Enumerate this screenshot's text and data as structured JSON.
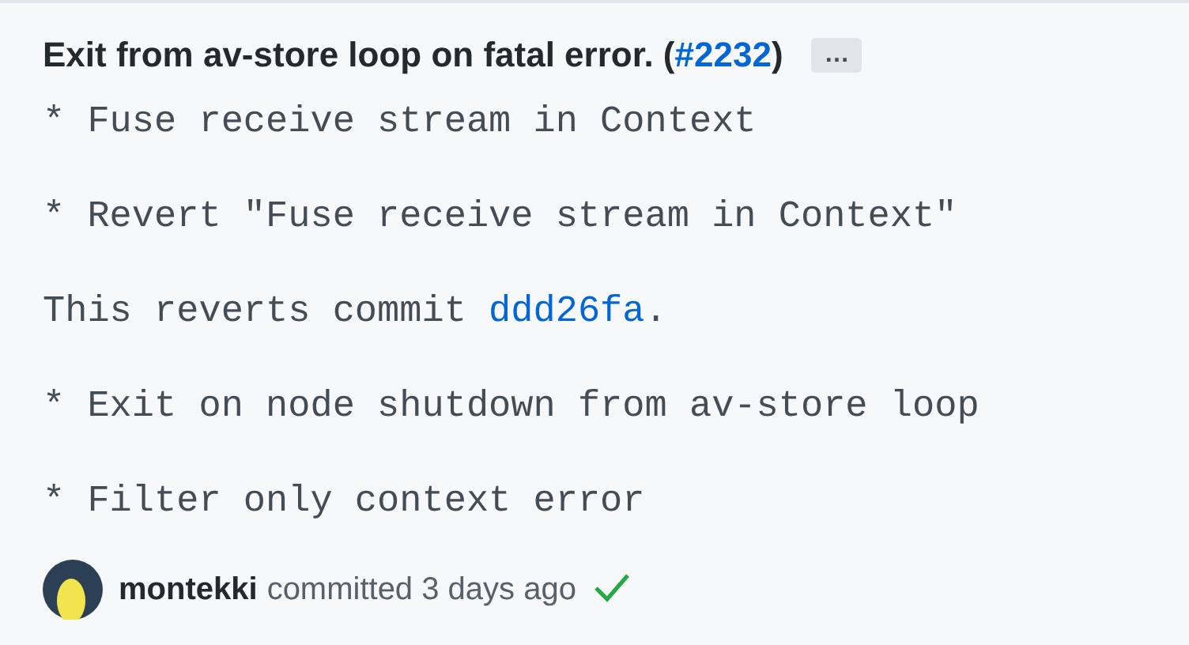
{
  "commit": {
    "title": "Exit from av-store loop on fatal error. (",
    "pr_link": "#2232",
    "title_end": ")",
    "more_button": "…",
    "body": [
      {
        "text": "* Fuse receive stream in Context"
      },
      {
        "text": "* Revert \"Fuse receive stream in Context\""
      },
      {
        "text": "This reverts commit ",
        "link": "ddd26fa",
        "after": "."
      },
      {
        "text": "* Exit on node shutdown from av-store loop"
      },
      {
        "text": "* Filter only context error"
      }
    ],
    "author": "montekki",
    "meta": "committed 3 days ago",
    "checks_passed": true
  }
}
